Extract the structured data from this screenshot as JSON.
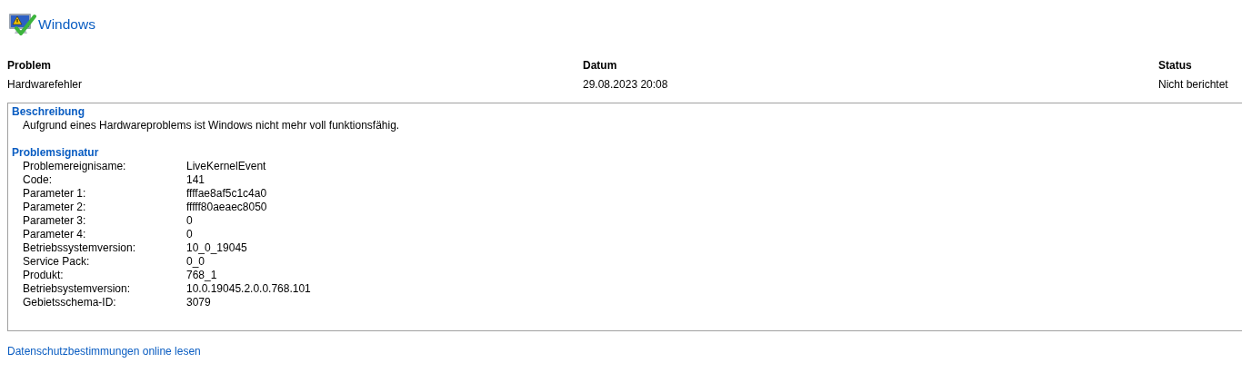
{
  "title": "Windows",
  "table": {
    "columns": [
      "Problem",
      "Datum",
      "Status"
    ],
    "row": [
      "Hardwarefehler",
      "29.08.2023 20:08",
      "Nicht berichtet"
    ]
  },
  "details": {
    "sections": [
      {
        "kind": "text",
        "heading": "Beschreibung",
        "text": "Aufgrund eines Hardwareproblems ist Windows nicht mehr voll funktionsfähig."
      },
      {
        "kind": "pairs",
        "heading": "Problemsignatur",
        "pairs": [
          {
            "label": "Problemereignisame:",
            "value": "LiveKernelEvent"
          },
          {
            "label": "Code:",
            "value": "141"
          },
          {
            "label": "Parameter 1:",
            "value": "ffffae8af5c1c4a0"
          },
          {
            "label": "Parameter 2:",
            "value": "fffff80aeaec8050"
          },
          {
            "label": "Parameter 3:",
            "value": "0"
          },
          {
            "label": "Parameter 4:",
            "value": "0"
          },
          {
            "label": "Betriebssystemversion:",
            "value": "10_0_19045"
          },
          {
            "label": "Service Pack:",
            "value": "0_0"
          },
          {
            "label": "Produkt:",
            "value": "768_1"
          },
          {
            "label": "Betriebsystemversion:",
            "value": "10.0.19045.2.0.0.768.101"
          },
          {
            "label": "Gebietsschema-ID:",
            "value": "3079"
          }
        ]
      }
    ]
  },
  "link": "Datenschutzbestimmungen online lesen"
}
